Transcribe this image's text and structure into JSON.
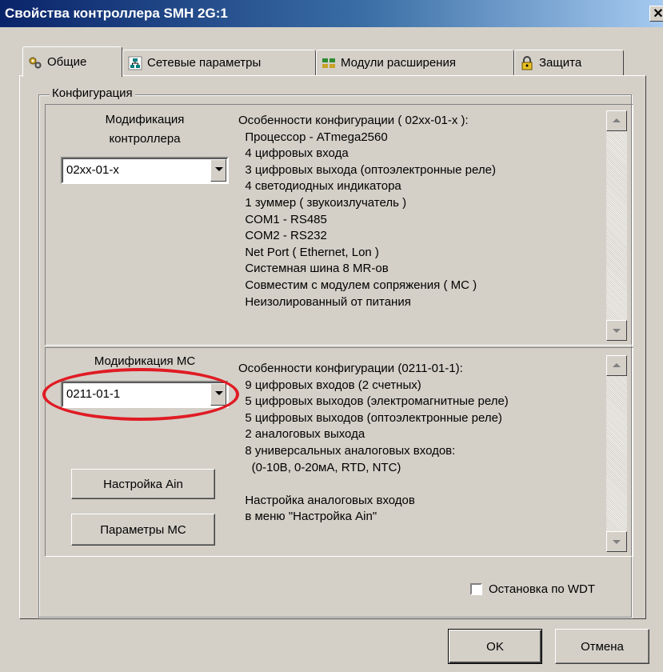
{
  "window": {
    "title": "Свойства контроллера SMH 2G:1",
    "close_glyph": "✕"
  },
  "tabs": [
    {
      "label": "Общие",
      "icon": "gears-icon",
      "active": true
    },
    {
      "label": "Сетевые параметры",
      "icon": "network-icon",
      "active": false
    },
    {
      "label": "Модули расширения",
      "icon": "modules-icon",
      "active": false
    },
    {
      "label": "Защита",
      "icon": "lock-icon",
      "active": false
    }
  ],
  "config": {
    "group_label": "Конфигурация",
    "controller": {
      "label_line1": "Модификация",
      "label_line2": "контроллера",
      "selected": "02xx-01-x",
      "description": [
        "Особенности конфигурации ( 02xx-01-x ):",
        "  Процессор - ATmega2560",
        "  4 цифровых входа",
        "  3 цифровых выхода (оптоэлектронные реле)",
        "  4 светодиодных индикатора",
        "  1 зуммер ( звукоизлучатель )",
        "  COM1 - RS485",
        "  COM2 - RS232",
        "  Net Port ( Ethernet, Lon )",
        "  Системная шина 8 MR-ов",
        "  Совместим с модулем сопряжения ( МС )",
        "  Неизолированный от питания"
      ]
    },
    "mc": {
      "label": "Модификация МС",
      "selected": "0211-01-1",
      "description": [
        "Особенности конфигурации (0211-01-1):",
        "  9 цифровых входов (2 счетных)",
        "  5 цифровых выходов (электромагнитные реле)",
        "  5 цифровых выходов (оптоэлектронные реле)",
        "  2 аналоговых выхода",
        "  8 универсальных аналоговых входов:",
        "    (0-10В, 0-20мА, RTD, NTC)",
        "",
        "  Настройка аналоговых входов",
        "  в меню \"Настройка Ain\""
      ],
      "ain_button": "Настройка Ain",
      "params_button": "Параметры МС"
    },
    "wdt_checkbox": {
      "label": "Остановка по WDT",
      "checked": false
    }
  },
  "footer": {
    "ok_label": "OK",
    "cancel_label": "Отмена"
  },
  "annotation": {
    "color": "#e01b24"
  }
}
